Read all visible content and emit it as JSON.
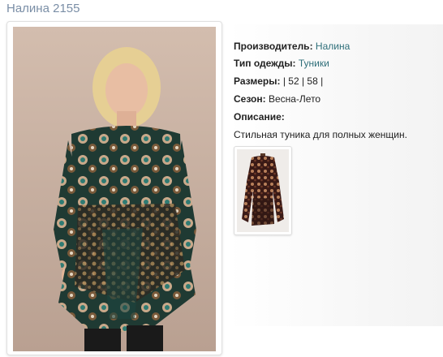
{
  "product": {
    "title": "Налина 2155"
  },
  "details": {
    "manufacturer_label": "Производитель:",
    "manufacturer_value": "Налина",
    "type_label": "Тип одежды:",
    "type_value": "Туники",
    "sizes_label": "Размеры:",
    "sizes_value": "| 52 | 58 |",
    "season_label": "Сезон:",
    "season_value": "Весна-Лето",
    "description_label": "Описание:",
    "description_text": "Стильная туника для полных женщин."
  },
  "colors": {
    "title": "#7a8ea6",
    "link": "#2f6f7a",
    "photo_bg": "#c9b2a2"
  }
}
